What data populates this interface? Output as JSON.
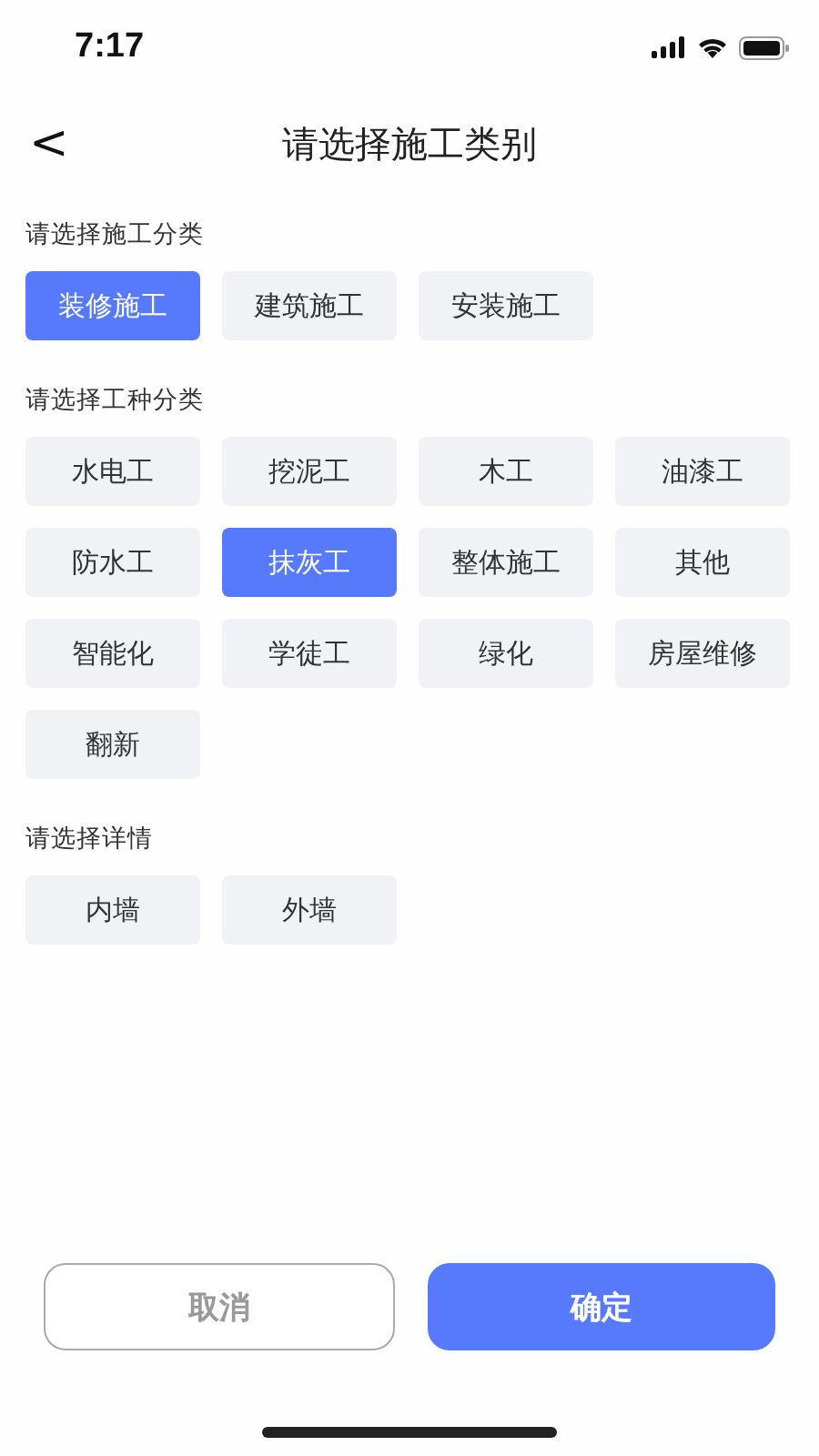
{
  "status_bar": {
    "time": "7:17"
  },
  "nav": {
    "back": "<",
    "title": "请选择施工类别"
  },
  "sections": [
    {
      "label": "请选择施工分类",
      "options": [
        {
          "label": "装修施工",
          "selected": true
        },
        {
          "label": "建筑施工",
          "selected": false
        },
        {
          "label": "安装施工",
          "selected": false
        }
      ]
    },
    {
      "label": "请选择工种分类",
      "options": [
        {
          "label": "水电工",
          "selected": false
        },
        {
          "label": "挖泥工",
          "selected": false
        },
        {
          "label": "木工",
          "selected": false
        },
        {
          "label": "油漆工",
          "selected": false
        },
        {
          "label": "防水工",
          "selected": false
        },
        {
          "label": "抹灰工",
          "selected": true
        },
        {
          "label": "整体施工",
          "selected": false
        },
        {
          "label": "其他",
          "selected": false
        },
        {
          "label": "智能化",
          "selected": false
        },
        {
          "label": "学徒工",
          "selected": false
        },
        {
          "label": "绿化",
          "selected": false
        },
        {
          "label": "房屋维修",
          "selected": false
        },
        {
          "label": "翻新",
          "selected": false
        }
      ]
    },
    {
      "label": "请选择详情",
      "options": [
        {
          "label": "内墙",
          "selected": false
        },
        {
          "label": "外墙",
          "selected": false
        }
      ]
    }
  ],
  "buttons": [
    {
      "label": "取消",
      "kind": "secondary"
    },
    {
      "label": "确定",
      "kind": "primary"
    }
  ]
}
